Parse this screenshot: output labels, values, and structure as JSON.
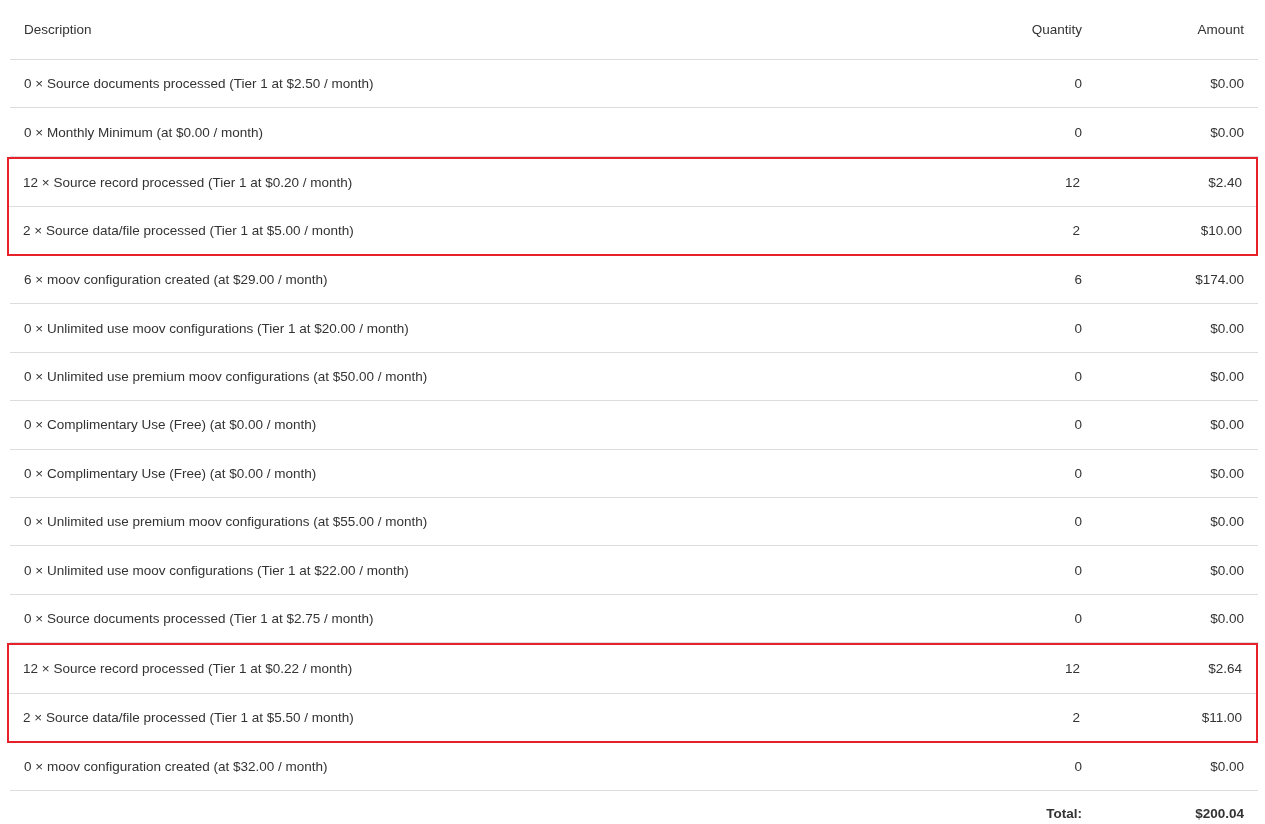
{
  "table": {
    "columns": [
      "Description",
      "Quantity",
      "Amount"
    ],
    "rows": [
      {
        "description": "0 × Source documents processed (Tier 1 at $2.50 / month)",
        "quantity": "0",
        "amount": "$0.00",
        "highlighted": false
      },
      {
        "description": "0 × Monthly Minimum (at $0.00 / month)",
        "quantity": "0",
        "amount": "$0.00",
        "highlighted": false
      },
      {
        "description": "12 × Source record processed (Tier 1 at $0.20 / month)",
        "quantity": "12",
        "amount": "$2.40",
        "highlighted": true
      },
      {
        "description": "2 × Source data/file processed (Tier 1 at $5.00 / month)",
        "quantity": "2",
        "amount": "$10.00",
        "highlighted": true
      },
      {
        "description": "6 × moov configuration created (at $29.00 / month)",
        "quantity": "6",
        "amount": "$174.00",
        "highlighted": false
      },
      {
        "description": "0 × Unlimited use moov configurations (Tier 1 at $20.00 / month)",
        "quantity": "0",
        "amount": "$0.00",
        "highlighted": false
      },
      {
        "description": "0 × Unlimited use premium moov configurations (at $50.00 / month)",
        "quantity": "0",
        "amount": "$0.00",
        "highlighted": false
      },
      {
        "description": "0 × Complimentary Use (Free) (at $0.00 / month)",
        "quantity": "0",
        "amount": "$0.00",
        "highlighted": false
      },
      {
        "description": "0 × Complimentary Use (Free) (at $0.00 / month)",
        "quantity": "0",
        "amount": "$0.00",
        "highlighted": false
      },
      {
        "description": "0 × Unlimited use premium moov configurations (at $55.00 / month)",
        "quantity": "0",
        "amount": "$0.00",
        "highlighted": false
      },
      {
        "description": "0 × Unlimited use moov configurations (Tier 1 at $22.00 / month)",
        "quantity": "0",
        "amount": "$0.00",
        "highlighted": false
      },
      {
        "description": "0 × Source documents processed (Tier 1 at $2.75 / month)",
        "quantity": "0",
        "amount": "$0.00",
        "highlighted": false
      },
      {
        "description": "12 × Source record processed (Tier 1 at $0.22 / month)",
        "quantity": "12",
        "amount": "$2.64",
        "highlighted": true
      },
      {
        "description": "2 × Source data/file processed (Tier 1 at $5.50 / month)",
        "quantity": "2",
        "amount": "$11.00",
        "highlighted": true
      },
      {
        "description": "0 × moov configuration created (at $32.00 / month)",
        "quantity": "0",
        "amount": "$0.00",
        "highlighted": false
      }
    ],
    "total": {
      "label": "Total:",
      "amount": "$200.04"
    }
  }
}
